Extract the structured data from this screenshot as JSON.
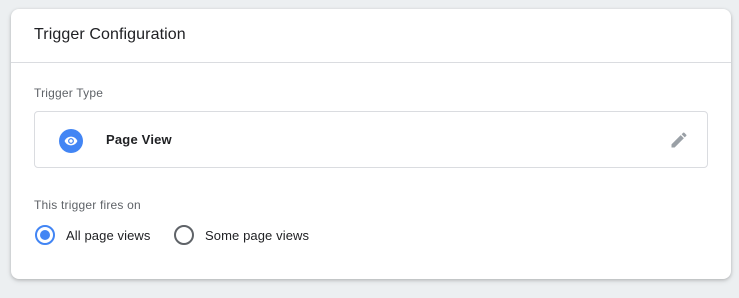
{
  "card": {
    "title": "Trigger Configuration"
  },
  "trigger_type": {
    "label": "Trigger Type",
    "name": "Page View",
    "icon": "eye-icon",
    "edit_icon": "pencil-icon",
    "accent_color": "#4285f4"
  },
  "fires_on": {
    "label": "This trigger fires on",
    "options": [
      {
        "label": "All page views",
        "checked": true
      },
      {
        "label": "Some page views",
        "checked": false
      }
    ]
  }
}
